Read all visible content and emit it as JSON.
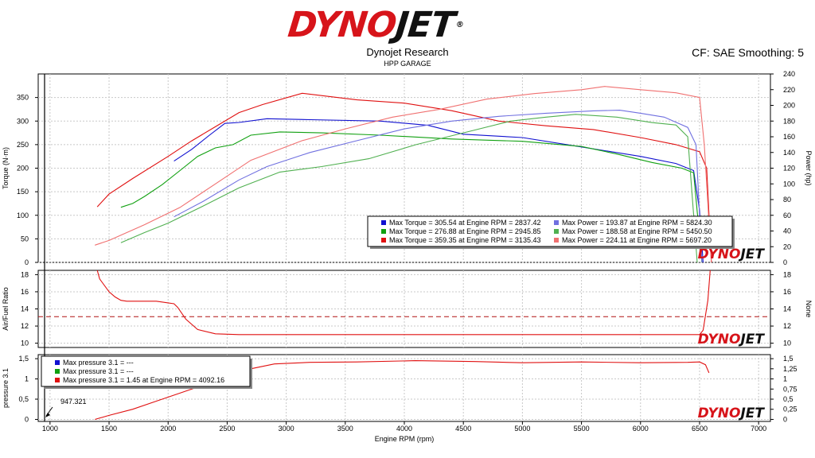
{
  "brand": {
    "part1": "DYNO",
    "part2": "JET",
    "reg": "®"
  },
  "header": {
    "company": "Dynojet Research",
    "garage": "HPP GARAGE",
    "correction": "CF: SAE Smoothing: 5"
  },
  "colors": {
    "blue": "#1010d0",
    "green": "#10a010",
    "red": "#e01010",
    "blue_light": "#7070e0",
    "green_light": "#50b050",
    "red_light": "#f07070"
  },
  "watermark": {
    "part1": "DYNO",
    "part2": "JET"
  },
  "cursor_readout": "947.321",
  "chart_data": [
    {
      "type": "line",
      "name": "torque-power",
      "xlabel": "Engine RPM (rpm)",
      "ylabel": "Torque (N·m)",
      "ylabel_right": "Power (hp)",
      "xlim": [
        900,
        7100
      ],
      "ylim": [
        0,
        400
      ],
      "ylim_right": [
        0,
        240
      ],
      "yticks": [
        0,
        50,
        100,
        150,
        200,
        250,
        300,
        350
      ],
      "yticks_right": [
        0,
        20,
        40,
        60,
        80,
        100,
        120,
        140,
        160,
        180,
        200,
        220,
        240
      ],
      "grid": true,
      "legend_position": "bottom-right",
      "legend": [
        "Max Torque = 305.54 at Engine RPM = 2837.42",
        "Max Torque = 276.88 at Engine RPM = 2945.85",
        "Max Torque = 359.35 at Engine RPM = 3135.43",
        "Max Power = 193.87 at Engine RPM = 5824.30",
        "Max Power = 188.58 at Engine RPM = 5450.50",
        "Max Power = 224.11 at Engine RPM = 5697.20"
      ],
      "series": [
        {
          "color": "blue",
          "axis": "left",
          "x": [
            2050,
            2200,
            2350,
            2480,
            2600,
            2837,
            3200,
            3800,
            4200,
            4500,
            5000,
            5500,
            6000,
            6300,
            6450,
            6500,
            6530
          ],
          "y": [
            215,
            240,
            270,
            295,
            297,
            305,
            303,
            300,
            291,
            272,
            265,
            245,
            225,
            210,
            195,
            110,
            0
          ]
        },
        {
          "color": "green",
          "axis": "left",
          "x": [
            1600,
            1700,
            1800,
            1950,
            2100,
            2250,
            2400,
            2550,
            2700,
            2946,
            3300,
            3800,
            4400,
            5000,
            5500,
            5800,
            6100,
            6350,
            6450,
            6520
          ],
          "y": [
            117,
            125,
            140,
            165,
            195,
            225,
            243,
            250,
            270,
            277,
            275,
            270,
            262,
            257,
            246,
            230,
            212,
            200,
            190,
            0
          ]
        },
        {
          "color": "red",
          "axis": "left",
          "x": [
            1400,
            1500,
            1700,
            2000,
            2200,
            2400,
            2600,
            2800,
            3135,
            3600,
            4000,
            4400,
            4800,
            5200,
            5600,
            6000,
            6300,
            6500,
            6560,
            6600
          ],
          "y": [
            118,
            145,
            178,
            225,
            258,
            288,
            318,
            335,
            359,
            345,
            338,
            322,
            300,
            290,
            282,
            265,
            250,
            235,
            200,
            0
          ]
        },
        {
          "color": "blue_light",
          "axis": "right",
          "x": [
            2050,
            2300,
            2600,
            2837,
            3200,
            3600,
            4000,
            4400,
            4800,
            5200,
            5600,
            5824,
            6000,
            6200,
            6400,
            6470,
            6520
          ],
          "y": [
            58,
            78,
            105,
            122,
            140,
            155,
            170,
            180,
            186,
            190,
            193,
            193.87,
            190,
            185,
            172,
            150,
            0
          ]
        },
        {
          "color": "green_light",
          "axis": "right",
          "x": [
            1600,
            1800,
            2000,
            2300,
            2600,
            2946,
            3300,
            3700,
            4100,
            4500,
            4900,
            5200,
            5450,
            5800,
            6100,
            6300,
            6400,
            6480
          ],
          "y": [
            25,
            38,
            50,
            72,
            95,
            115,
            122,
            132,
            150,
            165,
            180,
            185,
            188.58,
            185,
            178,
            175,
            160,
            0
          ]
        },
        {
          "color": "red_light",
          "axis": "right",
          "x": [
            1380,
            1500,
            1800,
            2100,
            2400,
            2700,
            3135,
            3500,
            3900,
            4300,
            4700,
            5100,
            5500,
            5697,
            6000,
            6300,
            6500,
            6540,
            6600
          ],
          "y": [
            22,
            28,
            48,
            70,
            100,
            130,
            155,
            170,
            185,
            195,
            208,
            215,
            220,
            224.11,
            220,
            216,
            210,
            150,
            0
          ]
        }
      ]
    },
    {
      "type": "line",
      "name": "air-fuel",
      "xlabel": "Engine RPM (rpm)",
      "ylabel": "Air/Fuel Ratio",
      "ylabel_right": "None",
      "xlim": [
        900,
        7100
      ],
      "ylim": [
        9.5,
        18.5
      ],
      "yticks": [
        10,
        12,
        14,
        16,
        18
      ],
      "grid": true,
      "reference_line": 13.1,
      "series": [
        {
          "color": "red",
          "x": [
            1400,
            1420,
            1500,
            1550,
            1600,
            1650,
            1700,
            1900,
            2050,
            2080,
            2150,
            2250,
            2400,
            2600,
            3000,
            4000,
            5000,
            6000,
            6500,
            6530,
            6570,
            6590
          ],
          "y": [
            18.5,
            17.5,
            16,
            15.4,
            15,
            14.9,
            14.9,
            14.9,
            14.6,
            14.2,
            12.8,
            11.6,
            11.1,
            11,
            11,
            11,
            11,
            11,
            11,
            11.5,
            15,
            18.5
          ]
        }
      ]
    },
    {
      "type": "line",
      "name": "pressure",
      "xlabel": "Engine RPM (rpm)",
      "ylabel": "pressure 3.1",
      "xlim": [
        900,
        7100
      ],
      "ylim": [
        -0.05,
        1.6
      ],
      "yticks": [
        0,
        0.5,
        1,
        1.5
      ],
      "ytick_labels": [
        "0",
        "0,5",
        "1",
        "1,5"
      ],
      "yticks_right": [
        0,
        0.25,
        0.5,
        0.75,
        1,
        1.25,
        1.5
      ],
      "ytick_labels_right": [
        "0",
        "0,25",
        "0,5",
        "0,75",
        "1",
        "1,25",
        "1,5"
      ],
      "grid": true,
      "legend_position": "top-left",
      "legend": [
        "Max pressure 3.1 = ---",
        "Max pressure 3.1 = ---",
        "Max pressure 3.1 = 1.45 at Engine RPM = 4092.16"
      ],
      "series": [
        {
          "color": "red",
          "x": [
            1380,
            1500,
            1700,
            1900,
            2100,
            2300,
            2500,
            2700,
            2900,
            3200,
            3600,
            4092,
            4600,
            5000,
            5500,
            6000,
            6400,
            6500,
            6550,
            6580
          ],
          "y": [
            0,
            0.1,
            0.25,
            0.45,
            0.65,
            0.85,
            1.05,
            1.25,
            1.37,
            1.41,
            1.42,
            1.45,
            1.43,
            1.4,
            1.42,
            1.4,
            1.41,
            1.42,
            1.35,
            1.15
          ]
        }
      ],
      "xticks": [
        1000,
        1500,
        2000,
        2500,
        3000,
        3500,
        4000,
        4500,
        5000,
        5500,
        6000,
        6500,
        7000
      ]
    }
  ]
}
